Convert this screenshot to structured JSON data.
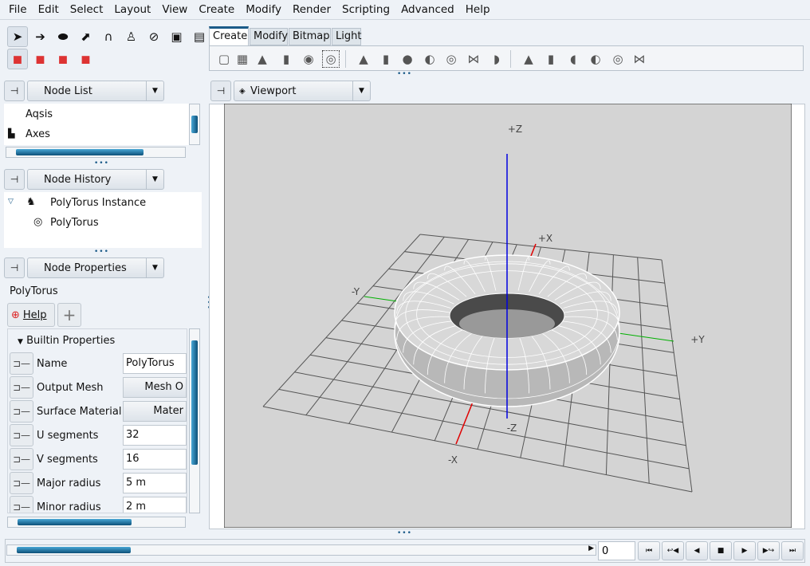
{
  "menu": [
    "File",
    "Edit",
    "Select",
    "Layout",
    "View",
    "Create",
    "Modify",
    "Render",
    "Scripting",
    "Advanced",
    "Help"
  ],
  "toolbar": {
    "tools_row1": [
      "select-arrow-icon",
      "move-icon",
      "rotate-icon",
      "scale-icon",
      "snap-magnet-icon",
      "parent-icon",
      "unparent-icon",
      "render-frame-icon",
      "render-animation-icon"
    ],
    "tools_row2": [
      "select-nodes-icon",
      "select-points-icon",
      "select-edges-icon",
      "select-faces-icon"
    ],
    "tabs": [
      "Create",
      "Modify",
      "Bitmap",
      "Light"
    ],
    "active_tab": "Create",
    "create_icons": [
      "poly-cube-icon",
      "poly-grid-icon",
      "poly-cone-icon",
      "poly-cylinder-icon",
      "poly-sphere-icon",
      "poly-torus-icon",
      "quadric-cone-icon",
      "quadric-cylinder-icon",
      "quadric-sphere-icon",
      "quadric-disk-icon",
      "quadric-torus-icon",
      "quadric-hyperboloid-icon",
      "quadric-paraboloid-icon",
      "nurbs-cone-icon",
      "nurbs-cylinder-icon",
      "nurbs-disk-icon",
      "nurbs-sphere-icon",
      "nurbs-torus-icon",
      "nurbs-hyperboloid-icon"
    ]
  },
  "node_list": {
    "title": "Node List",
    "items": [
      "Aqsis",
      "Axes"
    ]
  },
  "node_history": {
    "title": "Node History",
    "items": [
      "PolyTorus Instance",
      "PolyTorus"
    ]
  },
  "node_properties": {
    "title": "Node Properties",
    "node_name": "PolyTorus",
    "help_label": "Help",
    "section": "Builtin Properties",
    "rows": [
      {
        "label": "Name",
        "value": "PolyTorus",
        "type": "text"
      },
      {
        "label": "Output Mesh",
        "value": "Mesh O",
        "type": "button"
      },
      {
        "label": "Surface Material",
        "value": "Mater",
        "type": "button"
      },
      {
        "label": "U segments",
        "value": "32",
        "type": "text"
      },
      {
        "label": "V segments",
        "value": "16",
        "type": "text"
      },
      {
        "label": "Major radius",
        "value": "5 m",
        "type": "text"
      },
      {
        "label": "Minor radius",
        "value": "2 m",
        "type": "text"
      }
    ]
  },
  "viewport": {
    "title": "Viewport",
    "axes": {
      "pz": "+Z",
      "nz": "-Z",
      "px": "+X",
      "nx": "-X",
      "py": "+Y",
      "ny": "-Y"
    },
    "colors": {
      "x": "#e00000",
      "y": "#00b000",
      "z": "#0000e0",
      "background": "#d4d4d4"
    }
  },
  "timeline": {
    "frame": "0",
    "buttons": [
      "first-frame-icon",
      "play-reverse-loop-icon",
      "play-reverse-icon",
      "stop-icon",
      "play-icon",
      "play-loop-icon",
      "last-frame-icon"
    ],
    "progress": 0.2
  }
}
